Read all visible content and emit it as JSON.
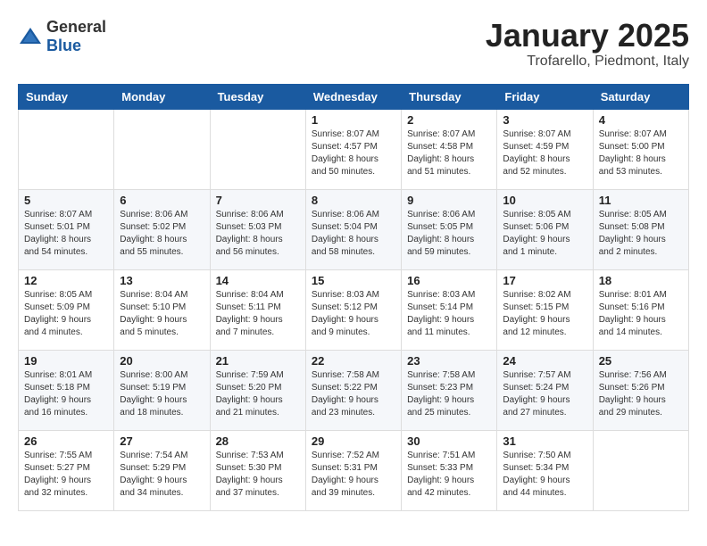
{
  "header": {
    "logo_general": "General",
    "logo_blue": "Blue",
    "month_title": "January 2025",
    "location": "Trofarello, Piedmont, Italy"
  },
  "weekdays": [
    "Sunday",
    "Monday",
    "Tuesday",
    "Wednesday",
    "Thursday",
    "Friday",
    "Saturday"
  ],
  "weeks": [
    [
      {
        "day": "",
        "content": ""
      },
      {
        "day": "",
        "content": ""
      },
      {
        "day": "",
        "content": ""
      },
      {
        "day": "1",
        "content": "Sunrise: 8:07 AM\nSunset: 4:57 PM\nDaylight: 8 hours\nand 50 minutes."
      },
      {
        "day": "2",
        "content": "Sunrise: 8:07 AM\nSunset: 4:58 PM\nDaylight: 8 hours\nand 51 minutes."
      },
      {
        "day": "3",
        "content": "Sunrise: 8:07 AM\nSunset: 4:59 PM\nDaylight: 8 hours\nand 52 minutes."
      },
      {
        "day": "4",
        "content": "Sunrise: 8:07 AM\nSunset: 5:00 PM\nDaylight: 8 hours\nand 53 minutes."
      }
    ],
    [
      {
        "day": "5",
        "content": "Sunrise: 8:07 AM\nSunset: 5:01 PM\nDaylight: 8 hours\nand 54 minutes."
      },
      {
        "day": "6",
        "content": "Sunrise: 8:06 AM\nSunset: 5:02 PM\nDaylight: 8 hours\nand 55 minutes."
      },
      {
        "day": "7",
        "content": "Sunrise: 8:06 AM\nSunset: 5:03 PM\nDaylight: 8 hours\nand 56 minutes."
      },
      {
        "day": "8",
        "content": "Sunrise: 8:06 AM\nSunset: 5:04 PM\nDaylight: 8 hours\nand 58 minutes."
      },
      {
        "day": "9",
        "content": "Sunrise: 8:06 AM\nSunset: 5:05 PM\nDaylight: 8 hours\nand 59 minutes."
      },
      {
        "day": "10",
        "content": "Sunrise: 8:05 AM\nSunset: 5:06 PM\nDaylight: 9 hours\nand 1 minute."
      },
      {
        "day": "11",
        "content": "Sunrise: 8:05 AM\nSunset: 5:08 PM\nDaylight: 9 hours\nand 2 minutes."
      }
    ],
    [
      {
        "day": "12",
        "content": "Sunrise: 8:05 AM\nSunset: 5:09 PM\nDaylight: 9 hours\nand 4 minutes."
      },
      {
        "day": "13",
        "content": "Sunrise: 8:04 AM\nSunset: 5:10 PM\nDaylight: 9 hours\nand 5 minutes."
      },
      {
        "day": "14",
        "content": "Sunrise: 8:04 AM\nSunset: 5:11 PM\nDaylight: 9 hours\nand 7 minutes."
      },
      {
        "day": "15",
        "content": "Sunrise: 8:03 AM\nSunset: 5:12 PM\nDaylight: 9 hours\nand 9 minutes."
      },
      {
        "day": "16",
        "content": "Sunrise: 8:03 AM\nSunset: 5:14 PM\nDaylight: 9 hours\nand 11 minutes."
      },
      {
        "day": "17",
        "content": "Sunrise: 8:02 AM\nSunset: 5:15 PM\nDaylight: 9 hours\nand 12 minutes."
      },
      {
        "day": "18",
        "content": "Sunrise: 8:01 AM\nSunset: 5:16 PM\nDaylight: 9 hours\nand 14 minutes."
      }
    ],
    [
      {
        "day": "19",
        "content": "Sunrise: 8:01 AM\nSunset: 5:18 PM\nDaylight: 9 hours\nand 16 minutes."
      },
      {
        "day": "20",
        "content": "Sunrise: 8:00 AM\nSunset: 5:19 PM\nDaylight: 9 hours\nand 18 minutes."
      },
      {
        "day": "21",
        "content": "Sunrise: 7:59 AM\nSunset: 5:20 PM\nDaylight: 9 hours\nand 21 minutes."
      },
      {
        "day": "22",
        "content": "Sunrise: 7:58 AM\nSunset: 5:22 PM\nDaylight: 9 hours\nand 23 minutes."
      },
      {
        "day": "23",
        "content": "Sunrise: 7:58 AM\nSunset: 5:23 PM\nDaylight: 9 hours\nand 25 minutes."
      },
      {
        "day": "24",
        "content": "Sunrise: 7:57 AM\nSunset: 5:24 PM\nDaylight: 9 hours\nand 27 minutes."
      },
      {
        "day": "25",
        "content": "Sunrise: 7:56 AM\nSunset: 5:26 PM\nDaylight: 9 hours\nand 29 minutes."
      }
    ],
    [
      {
        "day": "26",
        "content": "Sunrise: 7:55 AM\nSunset: 5:27 PM\nDaylight: 9 hours\nand 32 minutes."
      },
      {
        "day": "27",
        "content": "Sunrise: 7:54 AM\nSunset: 5:29 PM\nDaylight: 9 hours\nand 34 minutes."
      },
      {
        "day": "28",
        "content": "Sunrise: 7:53 AM\nSunset: 5:30 PM\nDaylight: 9 hours\nand 37 minutes."
      },
      {
        "day": "29",
        "content": "Sunrise: 7:52 AM\nSunset: 5:31 PM\nDaylight: 9 hours\nand 39 minutes."
      },
      {
        "day": "30",
        "content": "Sunrise: 7:51 AM\nSunset: 5:33 PM\nDaylight: 9 hours\nand 42 minutes."
      },
      {
        "day": "31",
        "content": "Sunrise: 7:50 AM\nSunset: 5:34 PM\nDaylight: 9 hours\nand 44 minutes."
      },
      {
        "day": "",
        "content": ""
      }
    ]
  ]
}
